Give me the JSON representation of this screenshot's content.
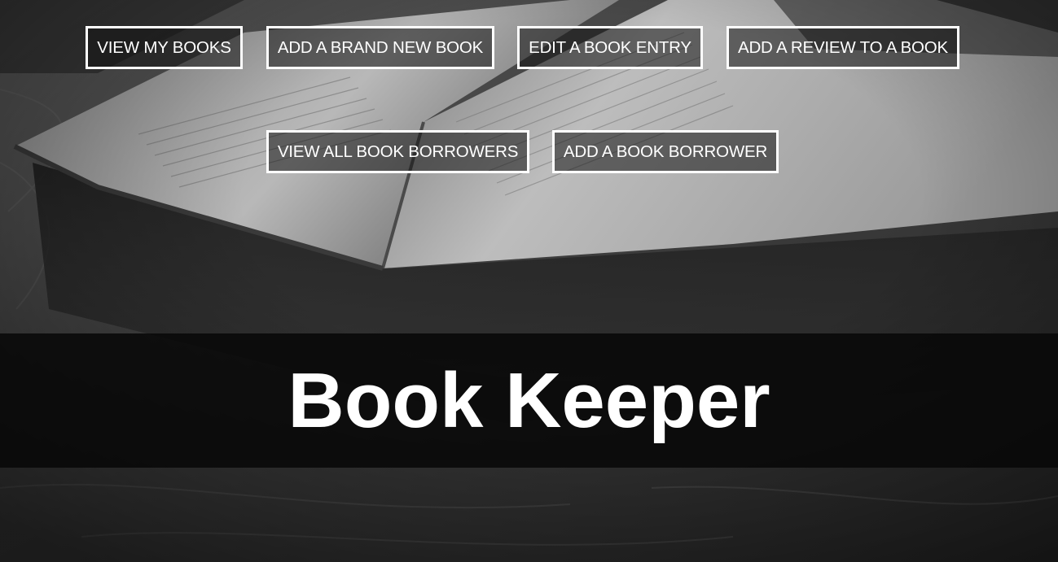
{
  "nav": {
    "row1": [
      {
        "label": "VIEW MY BOOKS"
      },
      {
        "label": "ADD A BRAND NEW BOOK"
      },
      {
        "label": "EDIT A BOOK ENTRY"
      },
      {
        "label": "ADD A REVIEW TO A BOOK"
      }
    ],
    "row2": [
      {
        "label": "VIEW ALL BOOK BORROWERS"
      },
      {
        "label": "ADD A BOOK BORROWER"
      }
    ]
  },
  "hero": {
    "title": "Book Keeper"
  },
  "colors": {
    "button_border": "#ffffff",
    "title_band": "#080808",
    "text": "#ffffff"
  }
}
